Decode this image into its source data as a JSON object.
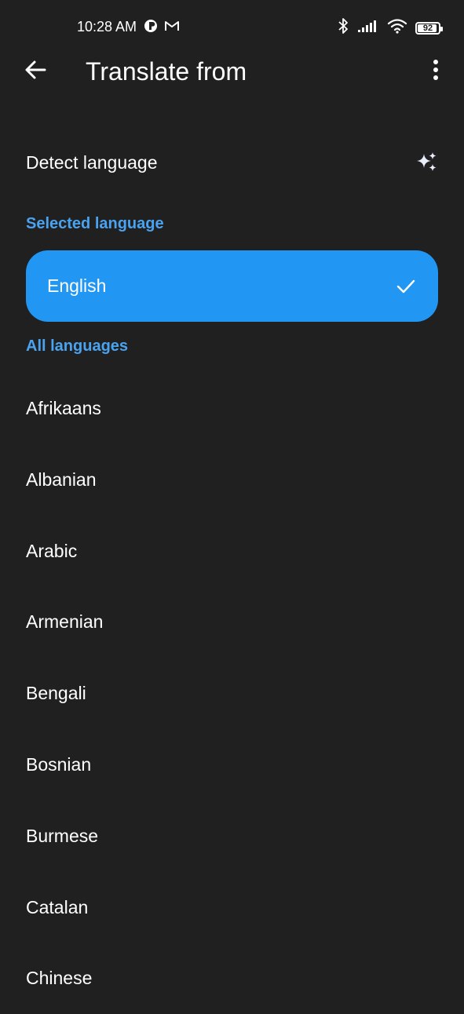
{
  "status_bar": {
    "time": "10:28 AM",
    "battery_level": "92",
    "battery_fraction": 0.92,
    "icons": [
      "pinterest-like-icon",
      "gmail-icon",
      "bluetooth-icon",
      "signal-icon",
      "wifi-icon",
      "battery-icon"
    ]
  },
  "app_bar": {
    "title": "Translate from",
    "back_icon": "arrow-back-icon",
    "more_icon": "more-vert-icon"
  },
  "detect": {
    "label": "Detect language",
    "icon": "sparkle-icon"
  },
  "selected_section": {
    "header": "Selected language",
    "language": "English",
    "icon": "check-icon"
  },
  "all_section": {
    "header": "All languages",
    "languages": [
      "Afrikaans",
      "Albanian",
      "Arabic",
      "Armenian",
      "Bengali",
      "Bosnian",
      "Burmese",
      "Catalan",
      "Chinese"
    ]
  },
  "colors": {
    "background": "#202020",
    "accent": "#2196f3",
    "section_header": "#4aa3f0",
    "text": "#ffffff"
  }
}
